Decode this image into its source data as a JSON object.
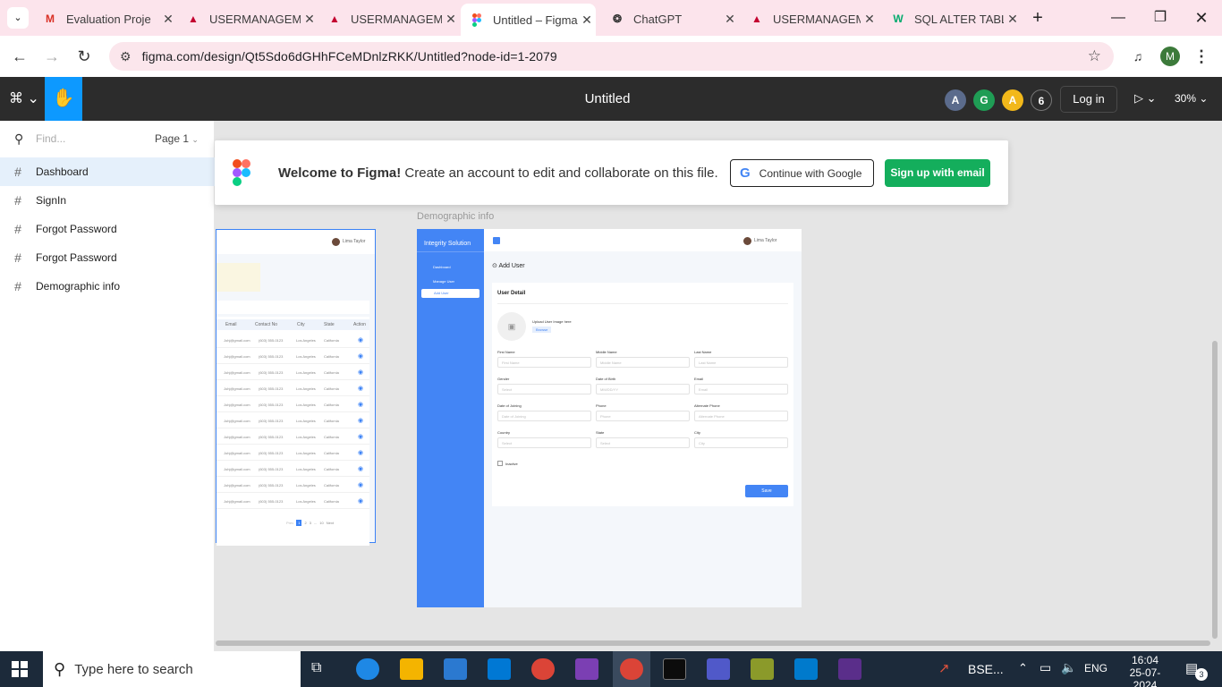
{
  "browser": {
    "tabs": [
      {
        "title": "Evaluation Proje",
        "icon": "gmail-icon"
      },
      {
        "title": "USERMANAGEM",
        "icon": "angular-icon"
      },
      {
        "title": "USERMANAGEM",
        "icon": "angular-icon"
      },
      {
        "title": "Untitled – Figma",
        "icon": "figma-icon",
        "active": true
      },
      {
        "title": "ChatGPT",
        "icon": "chatgpt-icon"
      },
      {
        "title": "USERMANAGEM",
        "icon": "angular-icon"
      },
      {
        "title": "SQL ALTER TABL",
        "icon": "w3schools-icon"
      }
    ],
    "url": "figma.com/design/Qt5Sdo6dGHhFCeMDnlzRKK/Untitled?node-id=1-2079",
    "profile_initial": "M"
  },
  "figma": {
    "title": "Untitled",
    "avatars": [
      {
        "letter": "A",
        "color": "#5b6b8c"
      },
      {
        "letter": "G",
        "color": "#1f9d55"
      },
      {
        "letter": "A",
        "color": "#f2b81a"
      }
    ],
    "viewer_count": "6",
    "login_label": "Log in",
    "zoom": "30%"
  },
  "sidebar": {
    "search_placeholder": "Find...",
    "page_selector": "Page 1",
    "frames": [
      "Dashboard",
      "SignIn",
      "Forgot Password",
      "Forgot Password",
      "Demographic info"
    ]
  },
  "banner": {
    "bold": "Welcome to Figma!",
    "text": "Create an account to edit and collaborate on this file.",
    "google_label": "Continue with Google",
    "email_label": "Sign up with email"
  },
  "frame_left": {
    "user": "Lima Taylor",
    "headers": [
      "Email",
      "Contact No",
      "City",
      "State",
      "Action"
    ],
    "rows": [
      [
        "Johj@gmail.com",
        "(603) 555-0123",
        "Los Angeles",
        "California"
      ],
      [
        "Johj@gmail.com",
        "(603) 555-0123",
        "Los Angeles",
        "California"
      ],
      [
        "Johj@gmail.com",
        "(603) 555-0123",
        "Los Angeles",
        "California"
      ],
      [
        "Johj@gmail.com",
        "(603) 555-0123",
        "Los Angeles",
        "California"
      ],
      [
        "Johj@gmail.com",
        "(603) 555-0123",
        "Los Angeles",
        "California"
      ],
      [
        "Johj@gmail.com",
        "(603) 555-0123",
        "Los Angeles",
        "California"
      ],
      [
        "Johj@gmail.com",
        "(603) 555-0123",
        "Los Angeles",
        "California"
      ],
      [
        "Johj@gmail.com",
        "(603) 555-0123",
        "Los Angeles",
        "California"
      ],
      [
        "Johj@gmail.com",
        "(603) 555-0123",
        "Los Angeles",
        "California"
      ],
      [
        "Johj@gmail.com",
        "(603) 555-0123",
        "Los Angeles",
        "California"
      ],
      [
        "Johj@gmail.com",
        "(603) 555-0123",
        "Los Angeles",
        "California"
      ]
    ],
    "pagination": [
      "Prev",
      "1",
      "2",
      "3",
      "...",
      "10",
      "Next"
    ]
  },
  "frame_right": {
    "label": "Demographic info",
    "brand": "Integrity Solution",
    "user": "Lima Taylor",
    "nav": [
      "Dashboard",
      "Manage User",
      "Add User"
    ],
    "page_title": "Add User",
    "card_title": "User Detail",
    "upload_label": "Upload User Image here",
    "browse": "Browse",
    "fields": [
      {
        "label": "First Name",
        "placeholder": "First Name"
      },
      {
        "label": "Middle Name",
        "placeholder": "Middle Name"
      },
      {
        "label": "Last Name",
        "placeholder": "Last Name"
      },
      {
        "label": "Gender",
        "placeholder": "Select"
      },
      {
        "label": "Date of Birth",
        "placeholder": "MM/DD/YY"
      },
      {
        "label": "Email",
        "placeholder": "Email"
      },
      {
        "label": "Date of Joining",
        "placeholder": "Date of Joining"
      },
      {
        "label": "Phone",
        "placeholder": "Phone"
      },
      {
        "label": "Alternate Phone",
        "placeholder": "Alternate Phone"
      },
      {
        "label": "Country",
        "placeholder": "Select"
      },
      {
        "label": "State",
        "placeholder": "Select"
      },
      {
        "label": "City",
        "placeholder": "City"
      }
    ],
    "inactive": "Inactive",
    "save": "Save"
  },
  "taskbar": {
    "search_placeholder": "Type here to search",
    "tray_app": "BSE...",
    "lang": "ENG",
    "time": "16:04",
    "date": "25-07-2024",
    "notifications": "3"
  }
}
